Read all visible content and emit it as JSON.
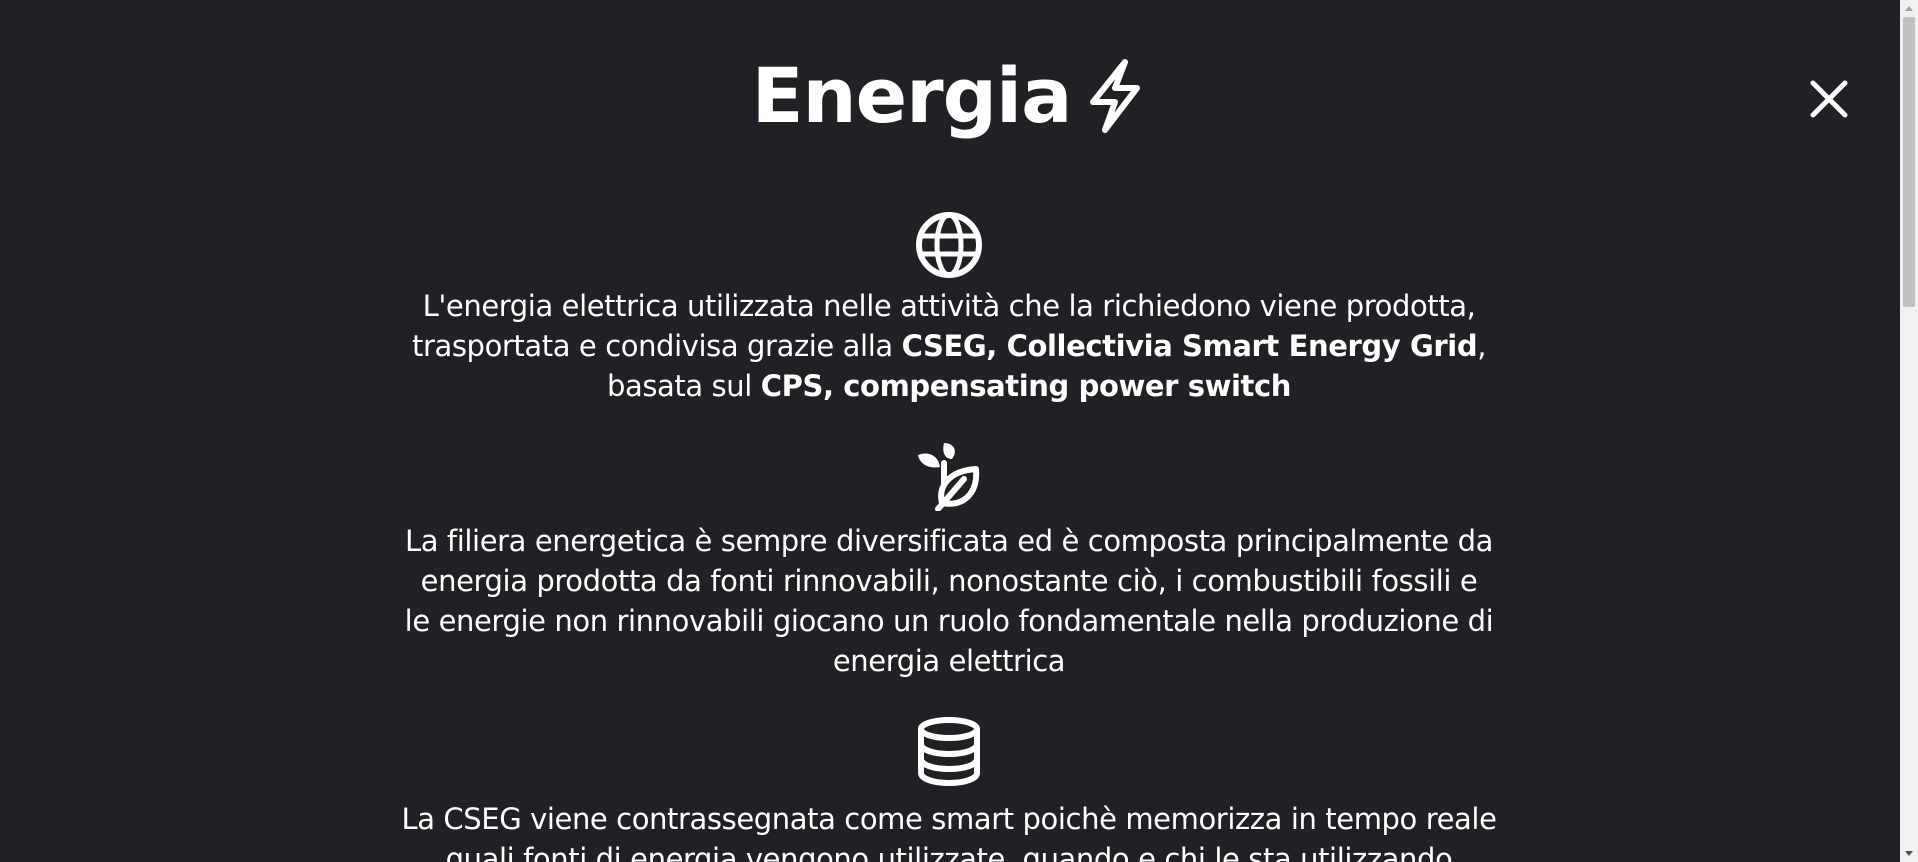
{
  "header": {
    "title": "Energia",
    "title_icon": "lightning-bolt-icon",
    "close_icon": "close-icon"
  },
  "sections": [
    {
      "icon": "globe-icon",
      "text_1": "L'energia elettrica utilizzata nelle attività che la richiedono viene prodotta, trasportata e condivisa grazie alla ",
      "bold_1": "CSEG, Collectivia Smart Energy Grid",
      "text_2": ", basata sul ",
      "bold_2": "CPS, compensating power switch"
    },
    {
      "icon": "leaf-seedling-icon",
      "text": "La filiera energetica è sempre diversificata ed è composta principalmente da energia prodotta da fonti rinnovabili, nonostante ciò, i combustibili fossili e le energie non rinnovabili giocano un ruolo fondamentale nella produzione di energia elettrica"
    },
    {
      "icon": "database-icon",
      "text": "La CSEG viene contrassegnata come smart poichè memorizza in tempo reale quali fonti di energia vengono utilizzate, quando e chi le sta utilizzando"
    }
  ],
  "colors": {
    "background": "#202124",
    "text": "#ffffff",
    "scrollbar_track": "#f1f1f1",
    "scrollbar_thumb": "#c1c1c1"
  }
}
